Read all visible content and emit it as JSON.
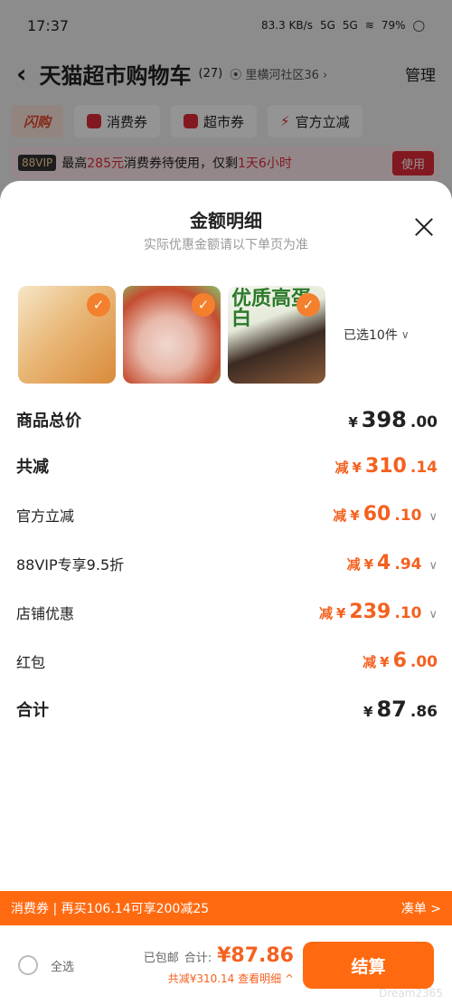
{
  "status": {
    "time": "17:37",
    "net_speed": "83.3 KB/s",
    "sig1": "5G",
    "sig2": "5G",
    "battery": "79%"
  },
  "header": {
    "title": "天猫超市购物车",
    "count": "(27)",
    "location": "里横河社区36",
    "manage": "管理"
  },
  "chips": [
    "闪购",
    "消费券",
    "超市券",
    "官方立减"
  ],
  "vip": {
    "tag": "88VIP",
    "text_a": "最高",
    "amount": "285元",
    "text_b": "消费券待使用，仅剩",
    "time": "1天6小时",
    "use": "使用"
  },
  "sheet": {
    "title": "金额明细",
    "subtitle": "实际优惠金额请以下单页为准",
    "selected": "已选10件",
    "thumb3_text": "优质高蛋白",
    "rows": [
      {
        "label": "商品总价",
        "prefix": "",
        "yen": "¥",
        "int": "398",
        "dec": ".00"
      },
      {
        "label": "共减",
        "prefix": "减",
        "yen": "¥",
        "int": "310",
        "dec": ".14"
      },
      {
        "label": "官方立减",
        "prefix": "减",
        "yen": "¥",
        "int": "60",
        "dec": ".10"
      },
      {
        "label": "88VIP专享9.5折",
        "prefix": "减",
        "yen": "¥",
        "int": "4",
        "dec": ".94"
      },
      {
        "label": "店铺优惠",
        "prefix": "减",
        "yen": "¥",
        "int": "239",
        "dec": ".10"
      },
      {
        "label": "红包",
        "prefix": "减",
        "yen": "¥",
        "int": "6",
        "dec": ".00"
      },
      {
        "label": "合计",
        "prefix": "",
        "yen": "¥",
        "int": "87",
        "dec": ".86"
      }
    ]
  },
  "coupon_bar": {
    "text": "消费券 | 再买106.14可享200减25",
    "right": "凑单 >"
  },
  "bottom": {
    "select_all": "全选",
    "shipping": "已包邮",
    "total_label": "合计:",
    "total": "¥87.86",
    "saved": "共减¥310.14 查看明细 ^",
    "checkout": "结算"
  },
  "watermark": "Dream2365"
}
